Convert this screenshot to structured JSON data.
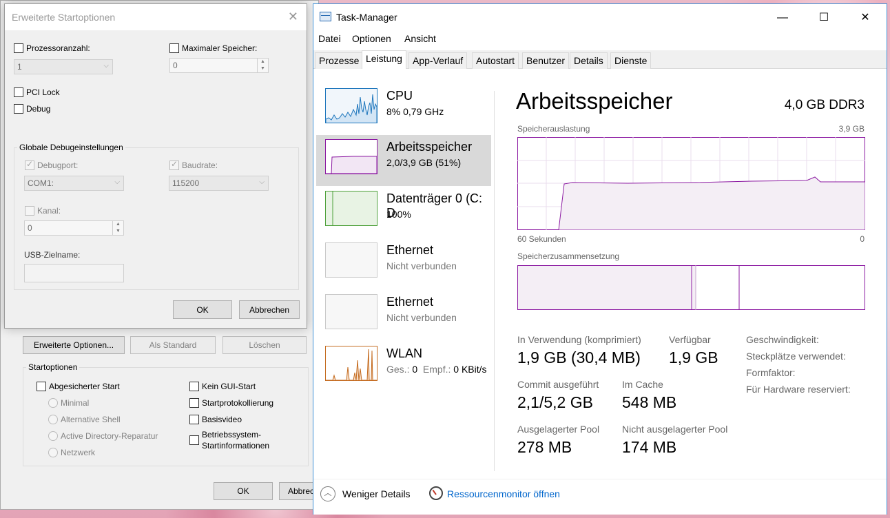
{
  "msconfig": {
    "buttons": {
      "advanced": "Erweiterte Optionen...",
      "default": "Als Standard",
      "delete": "Löschen",
      "ok": "OK",
      "cancel": "Abbrech"
    },
    "startoptions_group": "Startoptionen",
    "left_options": [
      "Abgesicherter Start",
      "Minimal",
      "Alternative Shell",
      "Active Directory-Reparatur",
      "Netzwerk"
    ],
    "right_options": [
      "Kein GUI-Start",
      "Startprotokollierung",
      "Basisvideo",
      "Betriebssystem-",
      "Startinformationen"
    ]
  },
  "dialog": {
    "title": "Erweiterte Startoptionen",
    "close_glyph": "✕",
    "processor_count_label": "Prozessoranzahl:",
    "processor_count_value": "1",
    "max_memory_label": "Maximaler Speicher:",
    "max_memory_value": "0",
    "pci_lock_label": "PCI Lock",
    "debug_label": "Debug",
    "debug_group_title": "Globale Debugeinstellungen",
    "debugport_label": "Debugport:",
    "debugport_value": "COM1:",
    "baudrate_label": "Baudrate:",
    "baudrate_value": "115200",
    "channel_label": "Kanal:",
    "channel_value": "0",
    "usb_target_label": "USB-Zielname:",
    "usb_target_value": "",
    "ok": "OK",
    "cancel": "Abbrechen"
  },
  "taskmanager": {
    "title": "Task-Manager",
    "window_buttons": {
      "minimize": "—",
      "maximize": "☐",
      "close": "✕"
    },
    "menu": [
      "Datei",
      "Optionen",
      "Ansicht"
    ],
    "tabs": [
      "Prozesse",
      "Leistung",
      "App-Verlauf",
      "Autostart",
      "Benutzer",
      "Details",
      "Dienste"
    ],
    "active_tab": "Leistung",
    "sidebar": [
      {
        "name": "CPU",
        "sub": "8%  0,79 GHz",
        "color": "#1c75bc"
      },
      {
        "name": "Arbeitsspeicher",
        "sub": "2,0/3,9 GB (51%)",
        "color": "#8b18a1"
      },
      {
        "name": "Datenträger 0 (C: D",
        "sub": "100%",
        "color": "#4da03a"
      },
      {
        "name": "Ethernet",
        "sub": "Nicht verbunden",
        "color": "#a8a8a8"
      },
      {
        "name": "Ethernet",
        "sub": "Nicht verbunden",
        "color": "#a8a8a8"
      },
      {
        "name": "WLAN",
        "sub_prefix": "Ges.: ",
        "sub_send": "0",
        "sub_mid": "  Empf.: ",
        "sub_recv": "0 KBit/s",
        "color": "#c46a1e"
      }
    ],
    "main": {
      "title": "Arbeitsspeicher",
      "meta": "4,0 GB DDR3",
      "usage_label": "Speicherauslastung",
      "usage_max": "3,9 GB",
      "time_label": "60 Sekunden",
      "time_end": "0",
      "composition_label": "Speicherzusammensetzung",
      "stats": {
        "in_use_label": "In Verwendung (komprimiert)",
        "in_use_value": "1,9 GB (30,4 MB)",
        "available_label": "Verfügbar",
        "available_value": "1,9 GB",
        "committed_label": "Commit ausgeführt",
        "committed_value": "2,1/5,2 GB",
        "cached_label": "Im Cache",
        "cached_value": "548 MB",
        "paged_label": "Ausgelagerter Pool",
        "paged_value": "278 MB",
        "nonpaged_label": "Nicht ausgelagerter Pool",
        "nonpaged_value": "174 MB"
      },
      "right_labels": [
        "Geschwindigkeit:",
        "Steckplätze verwendet:",
        "Formfaktor:",
        "Für Hardware reserviert:"
      ]
    },
    "footer": {
      "fewer_details": "Weniger Details",
      "resource_monitor": "Ressourcenmonitor öffnen"
    },
    "colors": {
      "memory": "#8b18a1",
      "memory_fill": "#f4eef5",
      "link": "#0066cc"
    }
  }
}
